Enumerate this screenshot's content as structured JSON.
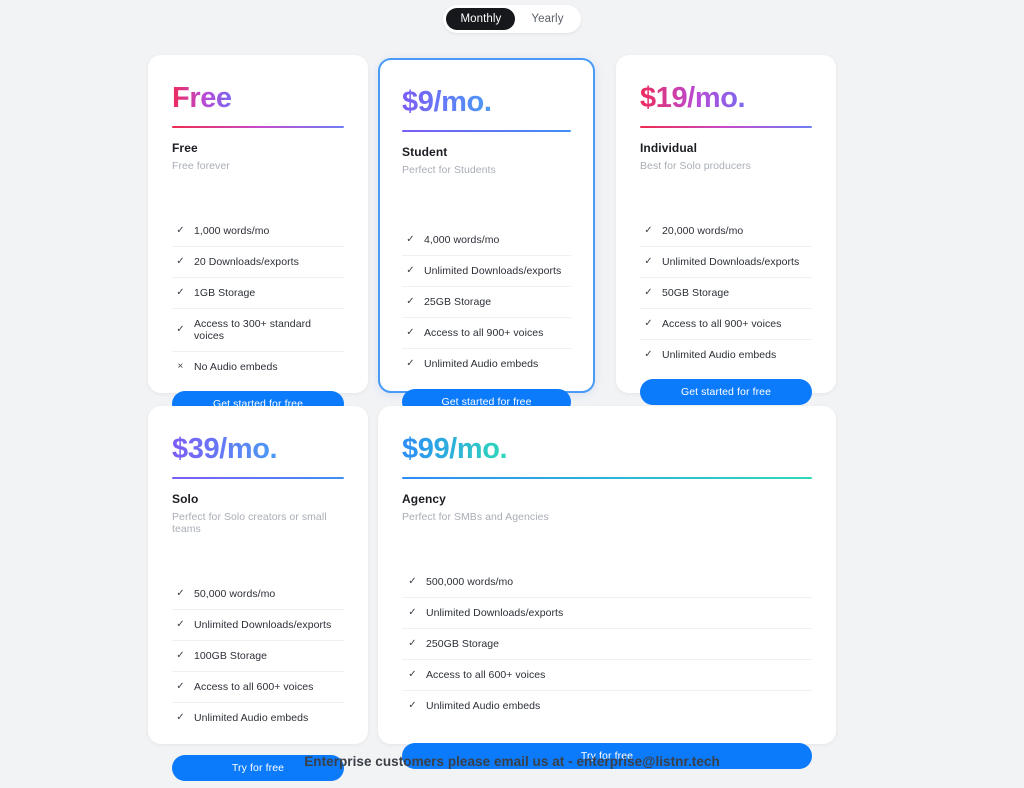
{
  "billing_toggle": {
    "options": [
      {
        "label": "Monthly",
        "selected": true
      },
      {
        "label": "Yearly",
        "selected": false
      }
    ]
  },
  "icons": {
    "check": "✓",
    "cross": "×"
  },
  "colors": {
    "page_background": "#f2f3f5",
    "card_background": "#ffffff",
    "cta_blue": "#0b7bfb",
    "featured_border": "#4a9bf5",
    "toggle_active_background": "#16181c",
    "gradient_pink_start": "#ee2b5b",
    "gradient_pink_end": "#7b68ee",
    "gradient_purple_start": "#7d5cf6",
    "gradient_purple_end": "#4a9bf5",
    "gradient_blue_start": "#2d8cf8",
    "gradient_blue_end": "#2ed9b8"
  },
  "plans": [
    {
      "id": "free",
      "price": "Free",
      "name": "Free",
      "description": "Free forever",
      "featured": false,
      "cta": "Get started for free",
      "features": [
        {
          "text": "1,000 words/mo",
          "included": true
        },
        {
          "text": "20 Downloads/exports",
          "included": true
        },
        {
          "text": "1GB Storage",
          "included": true
        },
        {
          "text": "Access to 300+ standard voices",
          "included": true
        },
        {
          "text": "No Audio embeds",
          "included": false
        }
      ]
    },
    {
      "id": "student",
      "price": "$9/mo.",
      "name": "Student",
      "description": "Perfect for Students",
      "featured": true,
      "cta": "Get started for free",
      "features": [
        {
          "text": "4,000 words/mo",
          "included": true
        },
        {
          "text": "Unlimited Downloads/exports",
          "included": true
        },
        {
          "text": "25GB Storage",
          "included": true
        },
        {
          "text": "Access to all 900+ voices",
          "included": true
        },
        {
          "text": "Unlimited Audio embeds",
          "included": true
        }
      ]
    },
    {
      "id": "individual",
      "price": "$19/mo.",
      "name": "Individual",
      "description": "Best for Solo producers",
      "featured": false,
      "cta": "Get started for free",
      "features": [
        {
          "text": "20,000 words/mo",
          "included": true
        },
        {
          "text": "Unlimited Downloads/exports",
          "included": true
        },
        {
          "text": "50GB Storage",
          "included": true
        },
        {
          "text": "Access to all 900+ voices",
          "included": true
        },
        {
          "text": "Unlimited Audio embeds",
          "included": true
        }
      ]
    },
    {
      "id": "solo",
      "price": "$39/mo.",
      "name": "Solo",
      "description": "Perfect for Solo creators or small teams",
      "featured": false,
      "cta": "Try for free",
      "features": [
        {
          "text": "50,000 words/mo",
          "included": true
        },
        {
          "text": "Unlimited Downloads/exports",
          "included": true
        },
        {
          "text": "100GB Storage",
          "included": true
        },
        {
          "text": "Access to all 600+ voices",
          "included": true
        },
        {
          "text": "Unlimited Audio embeds",
          "included": true
        }
      ]
    },
    {
      "id": "agency",
      "price": "$99/mo.",
      "name": "Agency",
      "description": "Perfect for SMBs and Agencies",
      "featured": false,
      "cta": "Try for free",
      "features": [
        {
          "text": "500,000 words/mo",
          "included": true
        },
        {
          "text": "Unlimited Downloads/exports",
          "included": true
        },
        {
          "text": "250GB Storage",
          "included": true
        },
        {
          "text": "Access to all 600+ voices",
          "included": true
        },
        {
          "text": "Unlimited Audio embeds",
          "included": true
        }
      ]
    }
  ],
  "footer": {
    "text": "Enterprise customers please email us at - enterprise@listnr.tech"
  }
}
